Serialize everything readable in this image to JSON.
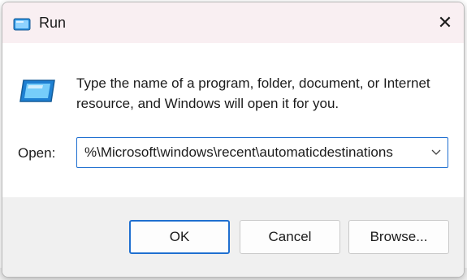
{
  "window": {
    "title": "Run",
    "close_glyph": "✕"
  },
  "dialog": {
    "prompt": "Type the name of a program, folder, document, or Internet resource, and Windows will open it for you.",
    "open_label": "Open:",
    "open_value": "%\\Microsoft\\windows\\recent\\automaticdestinations"
  },
  "buttons": {
    "ok": "OK",
    "cancel": "Cancel",
    "browse": "Browse..."
  },
  "icons": {
    "title": "run-icon",
    "app": "run-app-icon",
    "dropdown": "chevron-down-icon",
    "close": "close-icon"
  },
  "colors": {
    "accent": "#1f6fd0",
    "titlebar": "#f9eff2"
  }
}
